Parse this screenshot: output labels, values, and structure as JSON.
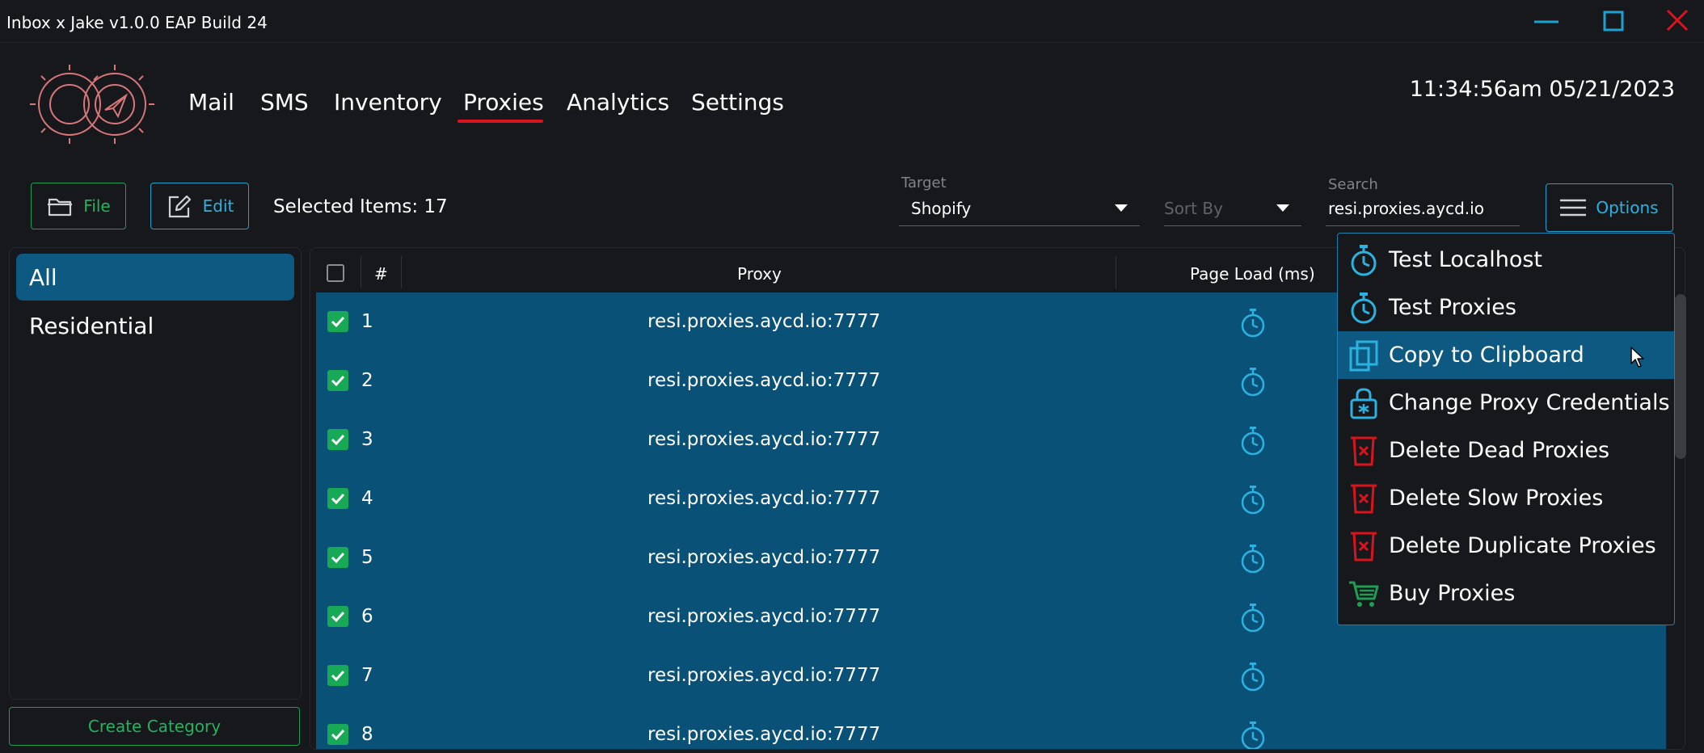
{
  "window": {
    "title": "Inbox x Jake v1.0.0 EAP Build 24"
  },
  "nav": {
    "items": [
      {
        "label": "Mail"
      },
      {
        "label": "SMS"
      },
      {
        "label": "Inventory"
      },
      {
        "label": "Proxies",
        "active": true
      },
      {
        "label": "Analytics"
      },
      {
        "label": "Settings"
      }
    ]
  },
  "clock": "11:34:56am 05/21/2023",
  "toolbar": {
    "file_label": "File",
    "edit_label": "Edit",
    "selected_items": "Selected Items: 17",
    "target_label": "Target",
    "target_value": "Shopify",
    "sort_placeholder": "Sort By",
    "search_label": "Search",
    "search_value": "resi.proxies.aycd.io",
    "options_label": "Options"
  },
  "sidebar": {
    "categories": [
      {
        "label": "All",
        "selected": true
      },
      {
        "label": "Residential"
      }
    ],
    "create_label": "Create Category"
  },
  "table": {
    "headers": [
      "#",
      "Proxy",
      "Page Load (ms)"
    ],
    "rows": [
      {
        "num": "1",
        "proxy": "resi.proxies.aycd.io:7777",
        "checked": true
      },
      {
        "num": "2",
        "proxy": "resi.proxies.aycd.io:7777",
        "checked": true
      },
      {
        "num": "3",
        "proxy": "resi.proxies.aycd.io:7777",
        "checked": true
      },
      {
        "num": "4",
        "proxy": "resi.proxies.aycd.io:7777",
        "checked": true
      },
      {
        "num": "5",
        "proxy": "resi.proxies.aycd.io:7777",
        "checked": true
      },
      {
        "num": "6",
        "proxy": "resi.proxies.aycd.io:7777",
        "checked": true
      },
      {
        "num": "7",
        "proxy": "resi.proxies.aycd.io:7777",
        "checked": true
      },
      {
        "num": "8",
        "proxy": "resi.proxies.aycd.io:7777",
        "checked": true
      }
    ]
  },
  "options_menu": {
    "items": [
      {
        "label": "Test Localhost",
        "icon": "stopwatch-icon"
      },
      {
        "label": "Test Proxies",
        "icon": "stopwatch-icon"
      },
      {
        "label": "Copy to Clipboard",
        "icon": "copy-icon",
        "highlighted": true
      },
      {
        "label": "Change Proxy Credentials",
        "icon": "lock-icon"
      },
      {
        "label": "Delete Dead Proxies",
        "icon": "delete-bin-icon"
      },
      {
        "label": "Delete Slow Proxies",
        "icon": "delete-bin-icon"
      },
      {
        "label": "Delete Duplicate Proxies",
        "icon": "delete-bin-icon"
      },
      {
        "label": "Buy Proxies",
        "icon": "cart-icon"
      }
    ]
  },
  "colors": {
    "background": "#17181c",
    "accent_blue": "#1ba2d0",
    "accent_green": "#1f9d52",
    "selection": "#0a5178",
    "danger": "#d9141c"
  }
}
